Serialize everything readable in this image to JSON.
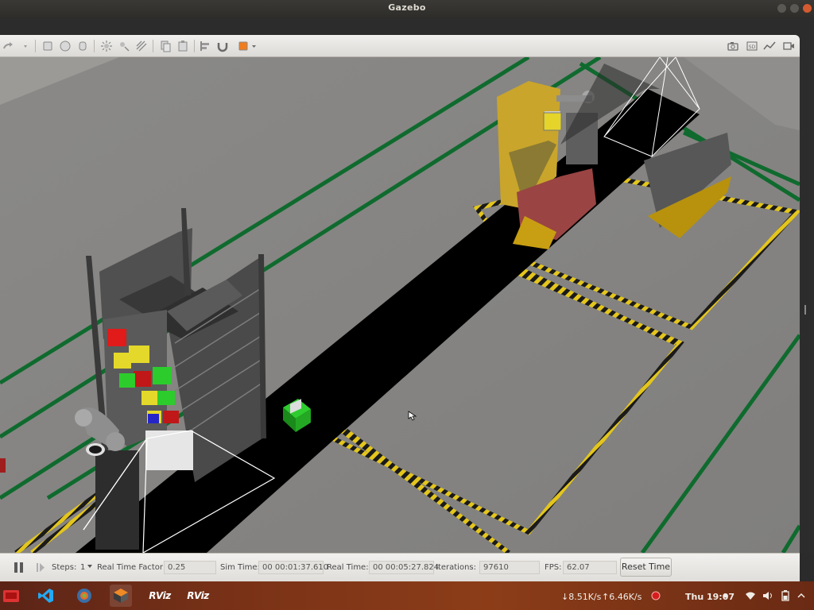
{
  "window": {
    "title": "Gazebo"
  },
  "statusbar": {
    "steps_label": "Steps:",
    "steps_value": "1",
    "rtf_label": "Real Time Factor:",
    "rtf_value": "0.25",
    "sim_time_label": "Sim Time:",
    "sim_time_value": "00 00:01:37.610",
    "real_time_label": "Real Time:",
    "real_time_value": "00 00:05:27.824",
    "iterations_label": "Iterations:",
    "iterations_value": "97610",
    "fps_label": "FPS:",
    "fps_value": "62.07",
    "reset_label": "Reset Time"
  },
  "taskbar": {
    "apps": [
      {
        "name": "ubuntu-software"
      },
      {
        "name": "vscode"
      },
      {
        "name": "browser"
      },
      {
        "name": "gazebo"
      },
      {
        "name": "rviz",
        "label": "RViz"
      },
      {
        "name": "rviz",
        "label": "RViz"
      }
    ],
    "net_down": "↓8.51K/s",
    "net_up": "↑6.46K/s",
    "clock": "Thu 19:07"
  },
  "colors": {
    "floor": "#858482",
    "belt": "#000000",
    "green_line": "#0f6a2e",
    "hazard_yellow": "#e3c51d",
    "toolbar_bg": "#e9e7e3",
    "taskbar": "#7a3217"
  }
}
